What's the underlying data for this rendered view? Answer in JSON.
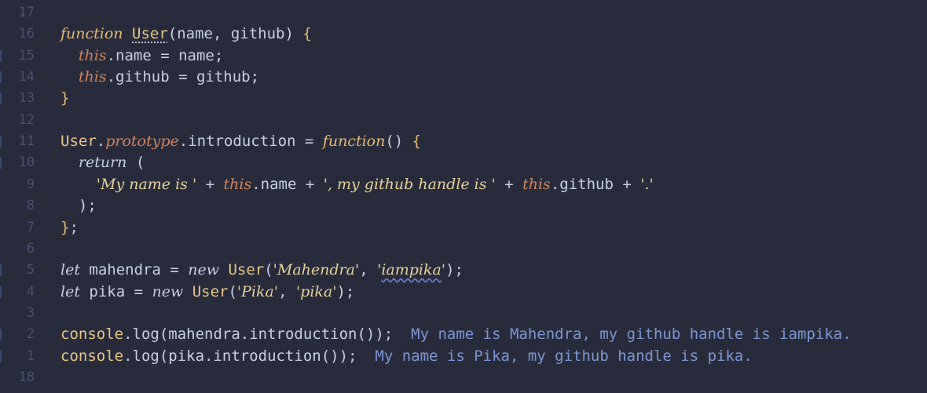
{
  "editor": {
    "background": "#282b3c",
    "lines": [
      {
        "n": "17",
        "mark": false,
        "tokens": []
      },
      {
        "n": "16",
        "mark": false,
        "tokens": [
          {
            "t": "function",
            "c": "c-kw-fn"
          },
          {
            "t": " ",
            "c": "c-plain"
          },
          {
            "t": "User",
            "c": "c-class",
            "u": "dotted"
          },
          {
            "t": "(name, github) ",
            "c": "c-plain"
          },
          {
            "t": "{",
            "c": "c-brace"
          }
        ]
      },
      {
        "n": "15",
        "mark": true,
        "tokens": [
          {
            "t": "  ",
            "c": "c-plain"
          },
          {
            "t": "this",
            "c": "c-this"
          },
          {
            "t": ".name = name;",
            "c": "c-plain"
          }
        ]
      },
      {
        "n": "14",
        "mark": true,
        "tokens": [
          {
            "t": "  ",
            "c": "c-plain"
          },
          {
            "t": "this",
            "c": "c-this"
          },
          {
            "t": ".github = github;",
            "c": "c-plain"
          }
        ]
      },
      {
        "n": "13",
        "mark": true,
        "tokens": [
          {
            "t": "}",
            "c": "c-brace"
          }
        ]
      },
      {
        "n": "12",
        "mark": false,
        "tokens": []
      },
      {
        "n": "11",
        "mark": true,
        "tokens": [
          {
            "t": "User",
            "c": "c-class"
          },
          {
            "t": ".",
            "c": "c-plain"
          },
          {
            "t": "prototype",
            "c": "c-proto"
          },
          {
            "t": ".introduction = ",
            "c": "c-plain"
          },
          {
            "t": "function",
            "c": "c-kw-fn"
          },
          {
            "t": "() ",
            "c": "c-plain"
          },
          {
            "t": "{",
            "c": "c-brace"
          }
        ]
      },
      {
        "n": "10",
        "mark": true,
        "tokens": [
          {
            "t": "  ",
            "c": "c-plain"
          },
          {
            "t": "return",
            "c": "c-ret"
          },
          {
            "t": " (",
            "c": "c-plain"
          }
        ]
      },
      {
        "n": "9",
        "mark": false,
        "tokens": [
          {
            "t": "    ",
            "c": "c-plain"
          },
          {
            "t": "'My name is '",
            "c": "c-str"
          },
          {
            "t": " + ",
            "c": "c-plain"
          },
          {
            "t": "this",
            "c": "c-this"
          },
          {
            "t": ".name + ",
            "c": "c-plain"
          },
          {
            "t": "', my github handle is '",
            "c": "c-str"
          },
          {
            "t": " + ",
            "c": "c-plain"
          },
          {
            "t": "this",
            "c": "c-this"
          },
          {
            "t": ".github + ",
            "c": "c-plain"
          },
          {
            "t": "'.'",
            "c": "c-str"
          }
        ]
      },
      {
        "n": "8",
        "mark": false,
        "tokens": [
          {
            "t": "  );",
            "c": "c-plain"
          }
        ]
      },
      {
        "n": "7",
        "mark": false,
        "tokens": [
          {
            "t": "}",
            "c": "c-brace"
          },
          {
            "t": ";",
            "c": "c-plain"
          }
        ]
      },
      {
        "n": "6",
        "mark": false,
        "tokens": []
      },
      {
        "n": "5",
        "mark": true,
        "tokens": [
          {
            "t": "let",
            "c": "c-let"
          },
          {
            "t": " mahendra = ",
            "c": "c-plain"
          },
          {
            "t": "new",
            "c": "c-new"
          },
          {
            "t": " ",
            "c": "c-plain"
          },
          {
            "t": "User",
            "c": "c-class"
          },
          {
            "t": "(",
            "c": "c-plain"
          },
          {
            "t": "'Mahendra'",
            "c": "c-str"
          },
          {
            "t": ", ",
            "c": "c-plain"
          },
          {
            "t": "'",
            "c": "c-str"
          },
          {
            "t": "iampika",
            "c": "c-str",
            "u": "squiggle"
          },
          {
            "t": "'",
            "c": "c-str"
          },
          {
            "t": ");",
            "c": "c-plain"
          }
        ]
      },
      {
        "n": "4",
        "mark": true,
        "tokens": [
          {
            "t": "let",
            "c": "c-let"
          },
          {
            "t": " pika = ",
            "c": "c-plain"
          },
          {
            "t": "new",
            "c": "c-new"
          },
          {
            "t": " ",
            "c": "c-plain"
          },
          {
            "t": "User",
            "c": "c-class"
          },
          {
            "t": "(",
            "c": "c-plain"
          },
          {
            "t": "'Pika'",
            "c": "c-str"
          },
          {
            "t": ", ",
            "c": "c-plain"
          },
          {
            "t": "'pika'",
            "c": "c-str"
          },
          {
            "t": ");",
            "c": "c-plain"
          }
        ]
      },
      {
        "n": "3",
        "mark": false,
        "tokens": []
      },
      {
        "n": "2",
        "mark": true,
        "tokens": [
          {
            "t": "console",
            "c": "c-console"
          },
          {
            "t": ".log(mahendra.introduction());",
            "c": "c-plain"
          },
          {
            "t": "  My name is Mahendra, my github handle is iampika.",
            "c": "c-output"
          }
        ]
      },
      {
        "n": "1",
        "mark": true,
        "tokens": [
          {
            "t": "console",
            "c": "c-console"
          },
          {
            "t": ".log(pika.introduction());",
            "c": "c-plain"
          },
          {
            "t": "  My name is Pika, my github handle is pika.",
            "c": "c-output"
          }
        ]
      },
      {
        "n": "18",
        "mark": false,
        "tokens": []
      }
    ]
  }
}
